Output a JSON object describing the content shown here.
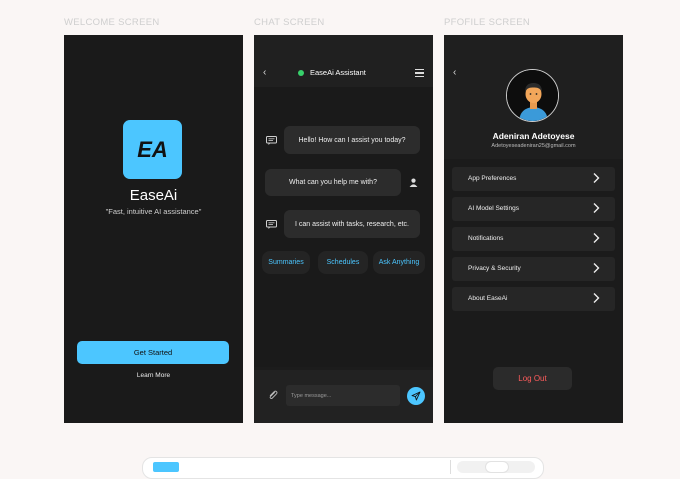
{
  "labels": {
    "welcome": "WELCOME SCREEN",
    "chat": "CHAT SCREEN",
    "profile": "PFOFILE SCREEN"
  },
  "welcome": {
    "logo_text": "EA",
    "app_name": "EaseAi",
    "tagline": "\"Fast, intuitive AI assistance\"",
    "get_started": "Get Started",
    "learn_more": "Learn More"
  },
  "chat": {
    "title": "EaseAi Assistant",
    "messages": [
      {
        "from": "bot",
        "text": "Hello! How can I assist you today?"
      },
      {
        "from": "user",
        "text": "What can you help me with?"
      },
      {
        "from": "bot",
        "text": "I can assist with tasks, research, etc."
      }
    ],
    "chips": [
      "Summaries",
      "Schedules",
      "Ask Anything"
    ],
    "input_placeholder": "Type message..."
  },
  "profile": {
    "name": "Adeniran Adetoyese",
    "email": "Adetoyeseadeniran25@gmail.com",
    "menu": [
      "App Preferences",
      "AI Model Settings",
      "Notifications",
      "Privacy & Security",
      "About EaseAi"
    ],
    "logout": "Log Out"
  },
  "colors": {
    "accent": "#4cc6ff",
    "online": "#37d06b",
    "logout": "#ff5c5c",
    "dark": "#1a1a1a"
  }
}
